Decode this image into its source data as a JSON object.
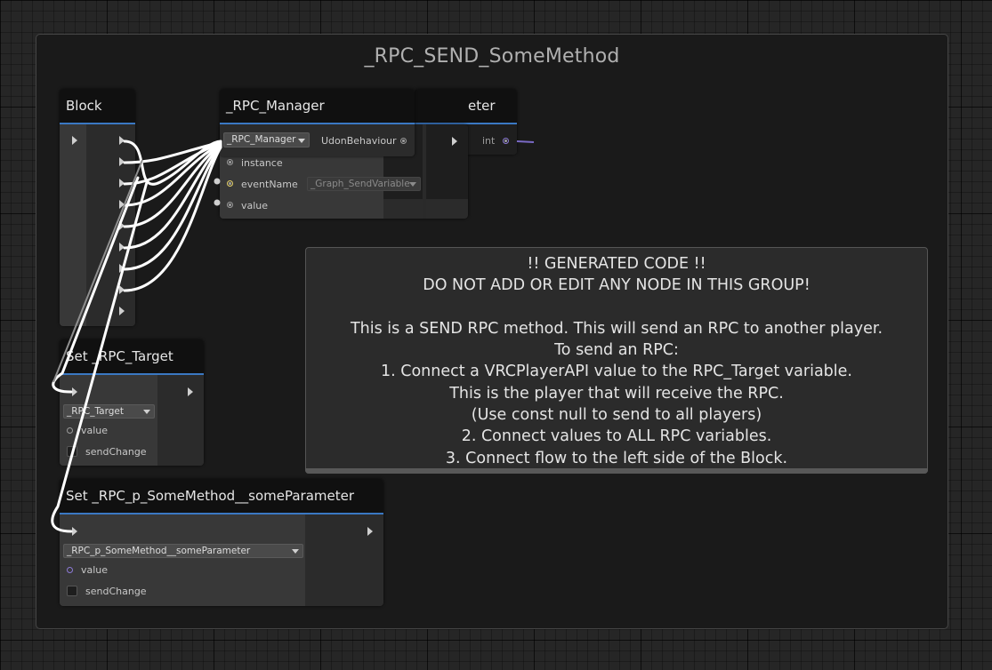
{
  "group": {
    "title": "_RPC_SEND_SomeMethod"
  },
  "block_node": {
    "title": "Block",
    "flow_outputs": 9
  },
  "rpc_manager_node": {
    "title": "_RPC_Manager",
    "dropdown": "_RPC_Manager",
    "type_label": "UdonBehaviour"
  },
  "set_variable_node": {
    "inputs": {
      "instance": "instance",
      "event_name": "eventName",
      "event_value": "_Graph_SendVariable",
      "value": "value"
    }
  },
  "hidden_node": {
    "title_fragment": "eter",
    "output_type": "int"
  },
  "set_target_node": {
    "title": "Set _RPC_Target",
    "dropdown": "_RPC_Target",
    "value_label": "value",
    "send_change_label": "sendChange"
  },
  "set_param_node": {
    "title": "Set _RPC_p_SomeMethod__someParameter",
    "dropdown": "_RPC_p_SomeMethod__someParameter",
    "value_label": "value",
    "send_change_label": "sendChange"
  },
  "comment": {
    "lines": [
      "!! GENERATED CODE !!",
      "DO NOT ADD OR EDIT ANY NODE IN THIS GROUP!",
      "",
      "This is a SEND RPC method. This will send an RPC to another player.",
      "To send an RPC:",
      "1. Connect a VRCPlayerAPI value to the RPC_Target variable.",
      "This is the player that will receive the RPC.",
      "(Use const null to send to all players)",
      "2. Connect values to ALL RPC variables.",
      "3. Connect flow to the left side of the Block."
    ]
  },
  "colors": {
    "header_accent": "#3a78c3",
    "wire": "#ffffff",
    "event_port": "#e8d36a",
    "int_port": "#8c7ad6"
  }
}
